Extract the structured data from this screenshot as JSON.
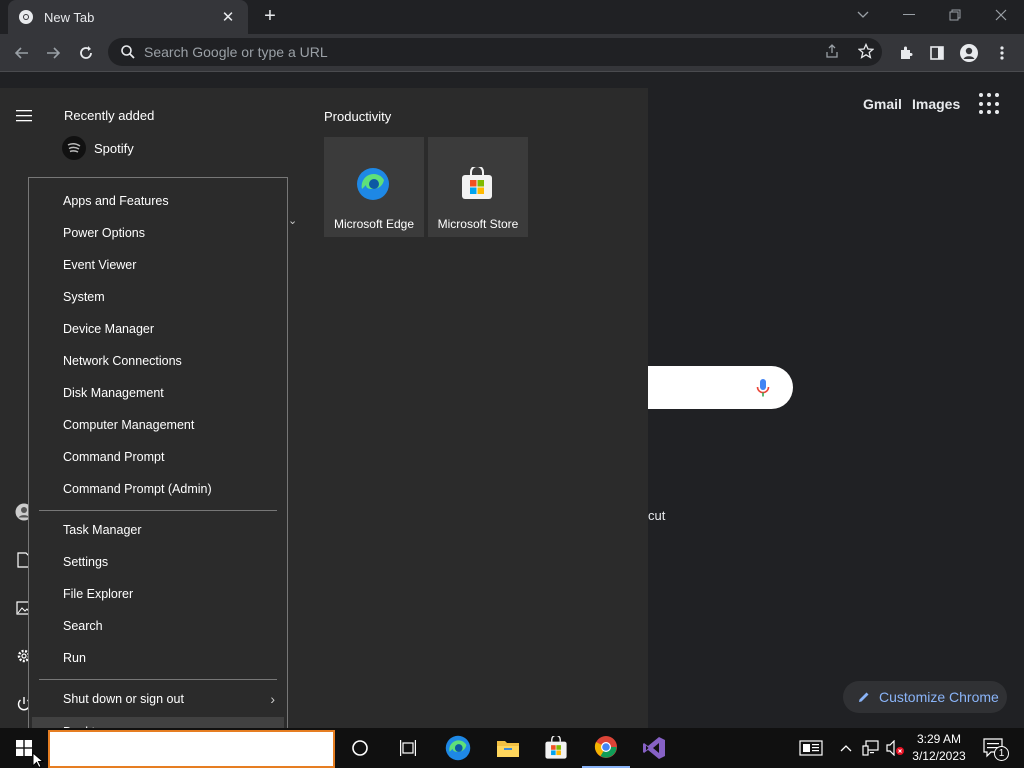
{
  "browser": {
    "tab_title": "New Tab",
    "omnibox_placeholder": "Search Google or type a URL"
  },
  "ntp": {
    "gmail": "Gmail",
    "images": "Images",
    "shortcut_partial": "cut",
    "customize_label": "Customize Chrome"
  },
  "start_menu": {
    "recent_header": "Recently added",
    "recent_app": "Spotify",
    "group_header": "Productivity",
    "tiles": [
      {
        "label": "Microsoft Edge"
      },
      {
        "label": "Microsoft Store"
      }
    ]
  },
  "context_menu": {
    "items": [
      "Apps and Features",
      "Power Options",
      "Event Viewer",
      "System",
      "Device Manager",
      "Network Connections",
      "Disk Management",
      "Computer Management",
      "Command Prompt",
      "Command Prompt (Admin)",
      "Task Manager",
      "Settings",
      "File Explorer",
      "Search",
      "Run",
      "Shut down or sign out",
      "Desktop"
    ]
  },
  "taskbar": {
    "time": "3:29 AM",
    "date": "3/12/2023",
    "notification_count": "1"
  }
}
